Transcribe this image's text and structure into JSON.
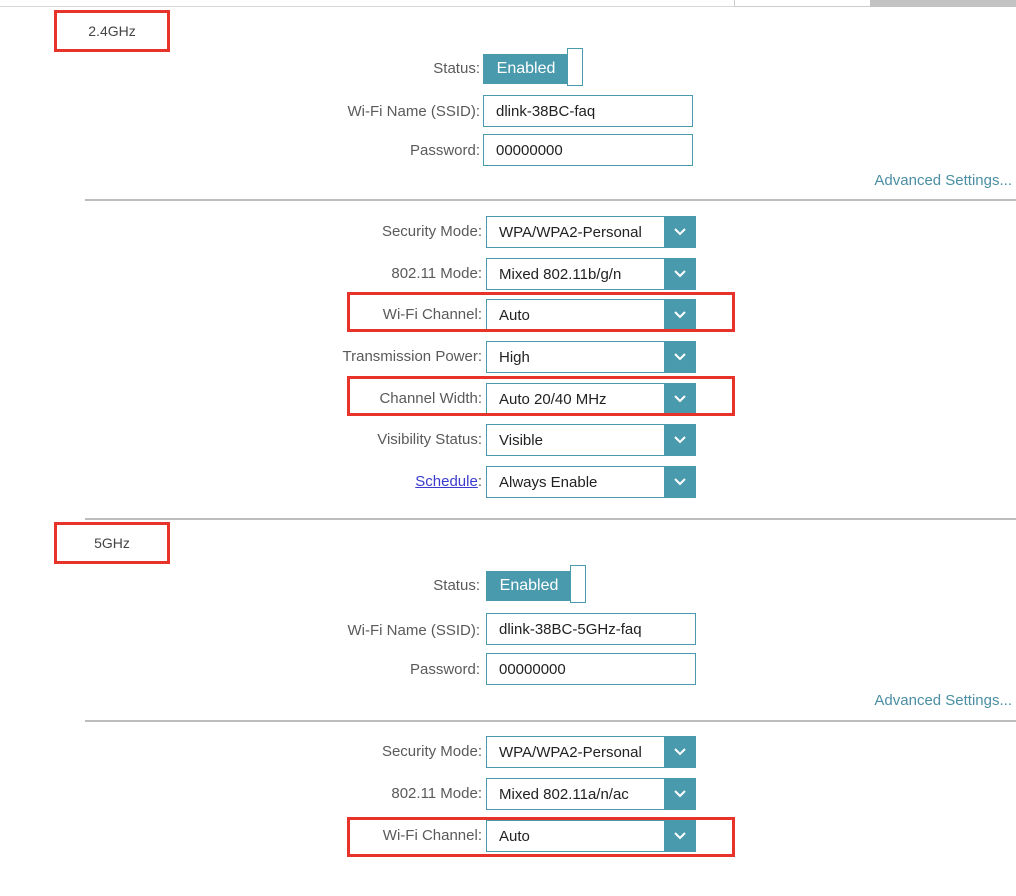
{
  "bands": [
    {
      "title": "2.4GHz",
      "status": {
        "label": "Status:",
        "value": "Enabled"
      },
      "ssid": {
        "label": "Wi-Fi Name (SSID):",
        "value": "dlink-38BC-faq"
      },
      "password": {
        "label": "Password:",
        "value": "00000000"
      },
      "advanced_link": "Advanced Settings...",
      "selects": [
        {
          "label": "Security Mode:",
          "value": "WPA/WPA2-Personal"
        },
        {
          "label": "802.11 Mode:",
          "value": "Mixed 802.11b/g/n"
        },
        {
          "label": "Wi-Fi Channel:",
          "value": "Auto"
        },
        {
          "label": "Transmission Power:",
          "value": "High"
        },
        {
          "label": "Channel Width:",
          "value": "Auto 20/40 MHz"
        },
        {
          "label": "Visibility Status:",
          "value": "Visible"
        },
        {
          "label": "Schedule",
          "label_suffix": ":",
          "value": "Always Enable"
        }
      ]
    },
    {
      "title": "5GHz",
      "status": {
        "label": "Status:",
        "value": "Enabled"
      },
      "ssid": {
        "label": "Wi-Fi Name (SSID):",
        "value": "dlink-38BC-5GHz-faq"
      },
      "password": {
        "label": "Password:",
        "value": "00000000"
      },
      "advanced_link": "Advanced Settings...",
      "selects": [
        {
          "label": "Security Mode:",
          "value": "WPA/WPA2-Personal"
        },
        {
          "label": "802.11 Mode:",
          "value": "Mixed 802.11a/n/ac"
        },
        {
          "label": "Wi-Fi Channel:",
          "value": "Auto"
        }
      ]
    }
  ],
  "colors": {
    "accent": "#4a9aad",
    "highlight": "#e8332a",
    "link": "#3a3acc"
  }
}
